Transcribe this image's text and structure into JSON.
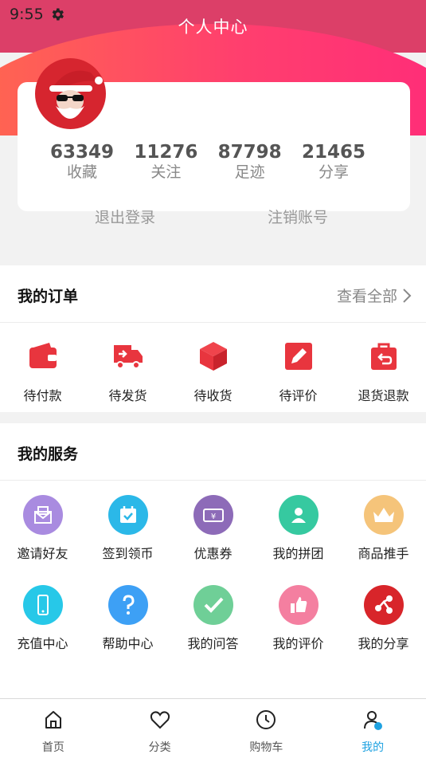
{
  "status": {
    "time": "9:55",
    "settings_icon": "gear-icon"
  },
  "header": {
    "title": "个人中心"
  },
  "profile": {
    "stats": [
      {
        "value": "63349",
        "label": "收藏"
      },
      {
        "value": "11276",
        "label": "关注"
      },
      {
        "value": "87798",
        "label": "足迹"
      },
      {
        "value": "21465",
        "label": "分享"
      }
    ],
    "logout": "退出登录",
    "deactivate": "注销账号"
  },
  "orders": {
    "title": "我的订单",
    "see_all": "查看全部",
    "items": [
      {
        "label": "待付款",
        "icon": "wallet-icon"
      },
      {
        "label": "待发货",
        "icon": "truck-icon"
      },
      {
        "label": "待收货",
        "icon": "box-icon"
      },
      {
        "label": "待评价",
        "icon": "edit-icon"
      },
      {
        "label": "退货退款",
        "icon": "return-bag-icon"
      }
    ]
  },
  "services": {
    "title": "我的服务",
    "items": [
      {
        "label": "邀请好友",
        "icon": "invite-icon",
        "color": "#a98be0"
      },
      {
        "label": "签到领币",
        "icon": "calendar-check-icon",
        "color": "#2bb8e8"
      },
      {
        "label": "优惠券",
        "icon": "coupon-icon",
        "color": "#8d6bb8"
      },
      {
        "label": "我的拼团",
        "icon": "group-user-icon",
        "color": "#36c9a0"
      },
      {
        "label": "商品推手",
        "icon": "crown-icon",
        "color": "#f5c47a"
      },
      {
        "label": "充值中心",
        "icon": "phone-icon",
        "color": "#27c8e8"
      },
      {
        "label": "帮助中心",
        "icon": "question-icon",
        "color": "#3da0f5"
      },
      {
        "label": "我的问答",
        "icon": "check-icon",
        "color": "#6fcf97"
      },
      {
        "label": "我的评价",
        "icon": "thumbs-up-icon",
        "color": "#f47fa0"
      },
      {
        "label": "我的分享",
        "icon": "share-icon",
        "color": "#d8252a"
      }
    ]
  },
  "tabbar": {
    "tabs": [
      {
        "label": "首页",
        "icon": "home-icon"
      },
      {
        "label": "分类",
        "icon": "heart-icon"
      },
      {
        "label": "购物车",
        "icon": "clock-icon"
      },
      {
        "label": "我的",
        "icon": "user-icon"
      }
    ],
    "active_color": "#1fa2e1"
  },
  "colors": {
    "header": "#dc3f68",
    "gradient_start": "#ff6a4d",
    "gradient_end": "#ff2a7a",
    "order_icon": "#e8353e"
  }
}
